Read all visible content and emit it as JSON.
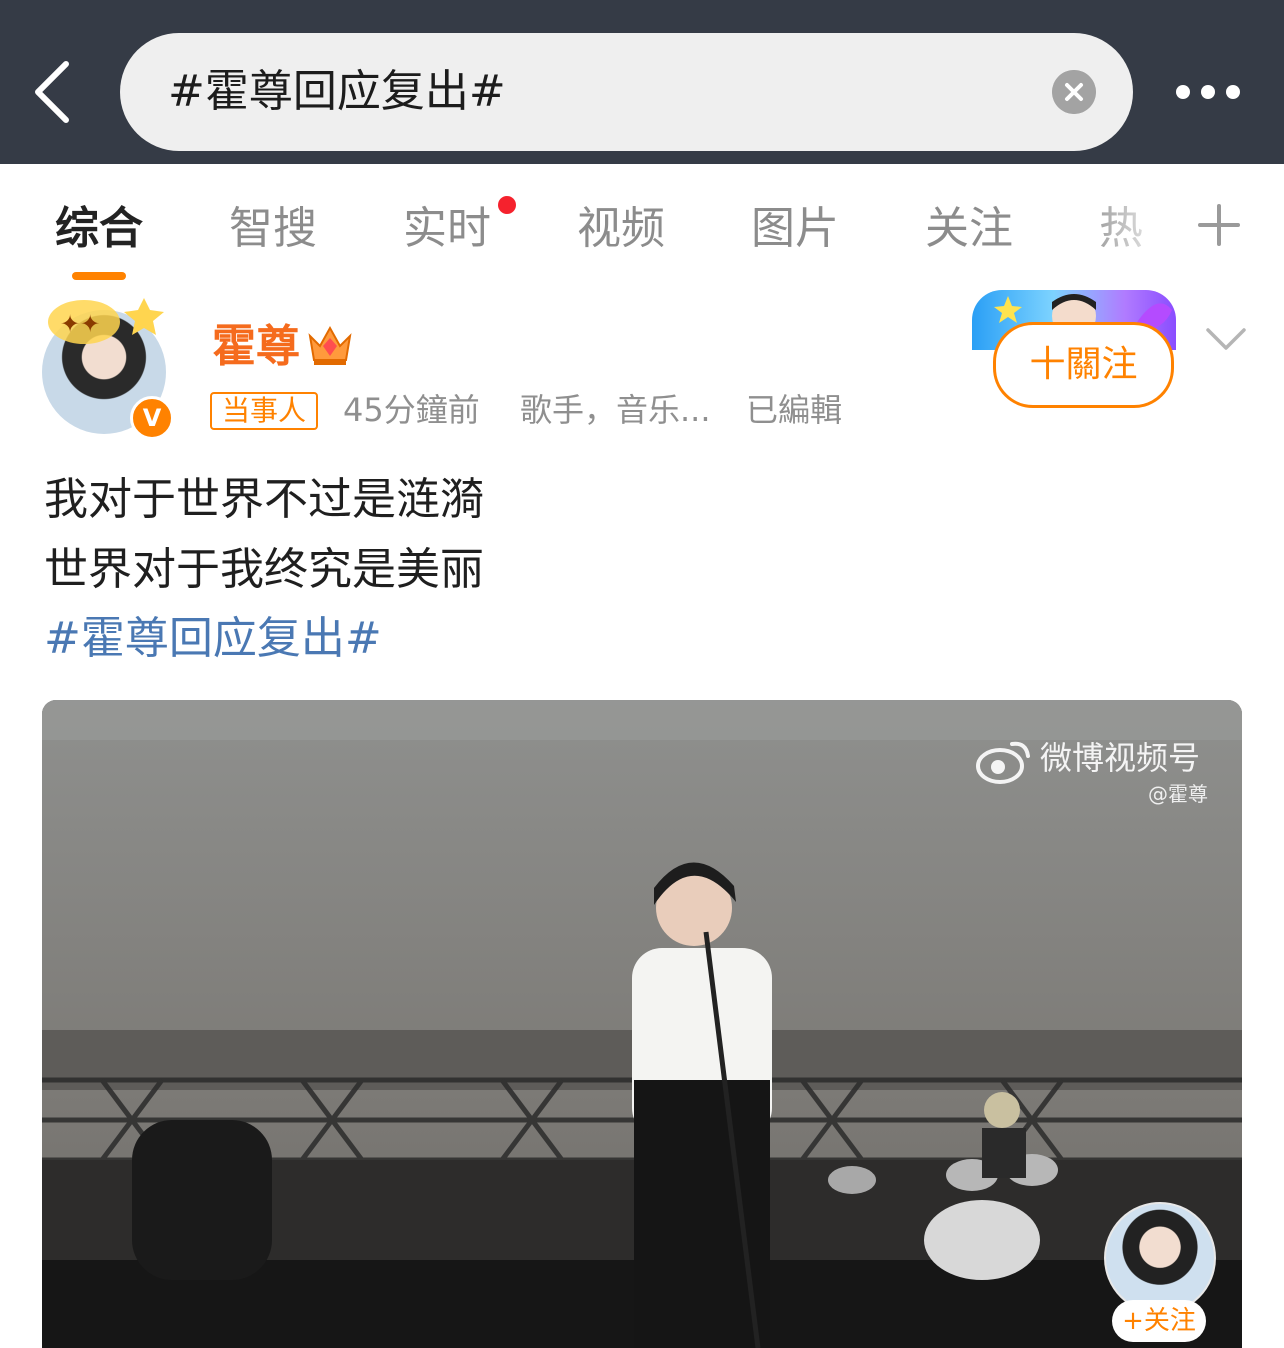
{
  "search": {
    "query": "#霍尊回应复出#"
  },
  "tabs": [
    {
      "label": "综合",
      "active": true
    },
    {
      "label": "智搜"
    },
    {
      "label": "实时",
      "has_dot": true
    },
    {
      "label": "视频"
    },
    {
      "label": "图片"
    },
    {
      "label": "关注"
    },
    {
      "label": "热"
    }
  ],
  "post": {
    "author": "霍尊",
    "badge": "当事人",
    "time": "45分鐘前",
    "bio": "歌手，音乐...",
    "edited": "已編輯",
    "follow_label": "十關注",
    "lines": [
      "我对于世界不过是涟漪",
      "世界对于我终究是美丽"
    ],
    "hashtag": "#霍尊回应复出#",
    "video": {
      "watermark": "微博视频号",
      "watermark_handle": "@霍尊",
      "mini_follow_label": "+关注"
    }
  },
  "colors": {
    "accent": "#ff8200",
    "topbar": "#353b46",
    "hashtag": "#4a78b3",
    "username": "#f56b1d"
  },
  "icons": [
    "back-arrow-icon",
    "clear-icon",
    "more-dots-icon",
    "add-tab-icon",
    "crown-icon",
    "verified-icon",
    "chevron-down-icon",
    "weibo-logo-icon"
  ]
}
